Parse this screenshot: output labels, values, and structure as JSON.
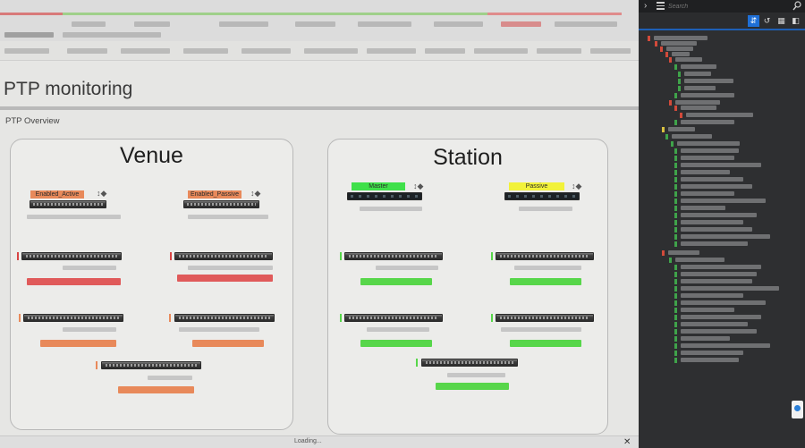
{
  "page": {
    "title": "PTP monitoring",
    "section": "PTP Overview",
    "status_text": "Loading...",
    "close_glyph": "✕"
  },
  "venue": {
    "title": "Venue",
    "tags": [
      "Enabled_Active",
      "Enabled_Passive"
    ],
    "tag_color": "#e8895a",
    "alarm_color": "#e05a5a",
    "warn_color": "#e8895a"
  },
  "station": {
    "title": "Station",
    "tags": [
      "Master",
      "Passive"
    ],
    "master_color": "#3fe04a",
    "passive_color": "#f2f23a",
    "ok_color": "#57d64a"
  },
  "side_panel": {
    "search_placeholder": "Search",
    "icons": [
      "chevron-right-icon",
      "menu-icon",
      "search-icon",
      "pin-icon",
      "history-icon",
      "grid-icon",
      "split-view-icon"
    ],
    "accent": "#1f6fd6"
  }
}
